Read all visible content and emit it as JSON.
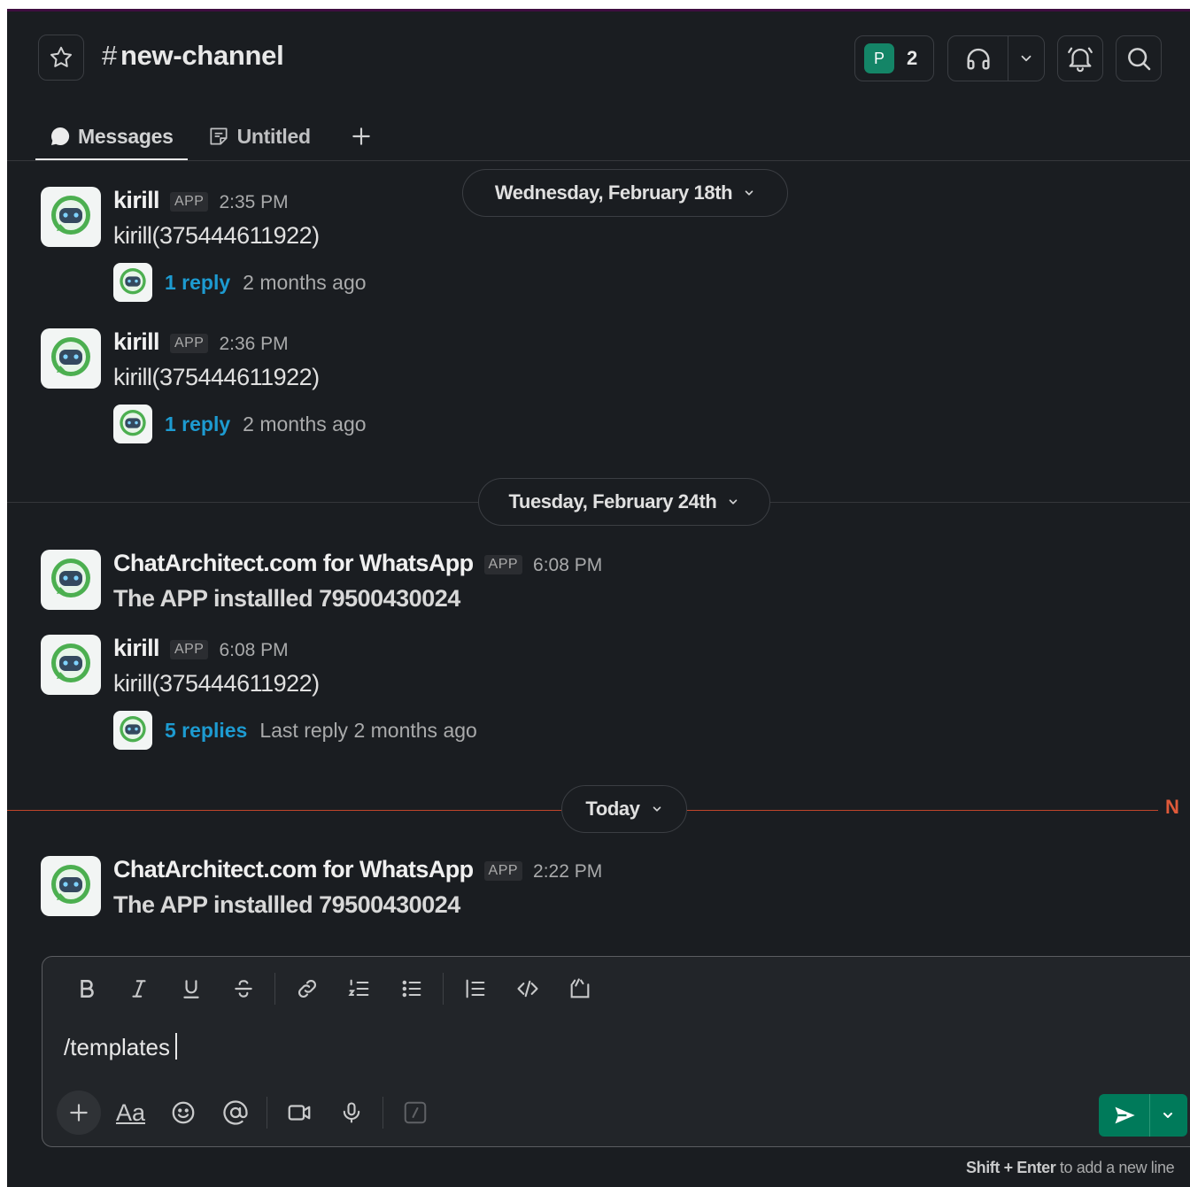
{
  "channel": {
    "hash": "#",
    "name": "new-channel"
  },
  "header": {
    "member_avatar_letter": "P",
    "member_count": "2"
  },
  "tabs": [
    {
      "label": "Messages"
    },
    {
      "label": "Untitled"
    }
  ],
  "dividers": [
    {
      "label": "Wednesday, February 18th"
    },
    {
      "label": "Tuesday, February 24th"
    },
    {
      "label": "Today"
    }
  ],
  "new_marker": "N",
  "messages": [
    {
      "name": "kirill",
      "tag": "APP",
      "time": "2:35 PM",
      "text": "kirill(375444611922)",
      "thread_link": "1 reply",
      "thread_meta": "2 months ago"
    },
    {
      "name": "kirill",
      "tag": "APP",
      "time": "2:36 PM",
      "text": "kirill(375444611922)",
      "thread_link": "1 reply",
      "thread_meta": "2 months ago"
    },
    {
      "name": "ChatArchitect.com for WhatsApp",
      "tag": "APP",
      "time": "6:08 PM",
      "text": "The APP installled 79500430024"
    },
    {
      "name": "kirill",
      "tag": "APP",
      "time": "6:08 PM",
      "text": "kirill(375444611922)",
      "thread_link": "5 replies",
      "thread_meta": "Last reply 2 months ago"
    },
    {
      "name": "ChatArchitect.com for WhatsApp",
      "tag": "APP",
      "time": "2:22 PM",
      "text": "The APP installled 79500430024"
    }
  ],
  "composer": {
    "value": "/templates",
    "text_style_label": "Aa",
    "hint_keys": "Shift + Enter",
    "hint_text": " to add a new line"
  },
  "colors": {
    "background": "#1a1d21",
    "accent_link": "#1d9bd1",
    "send_button": "#007a5a",
    "new_line": "#c0452b"
  }
}
